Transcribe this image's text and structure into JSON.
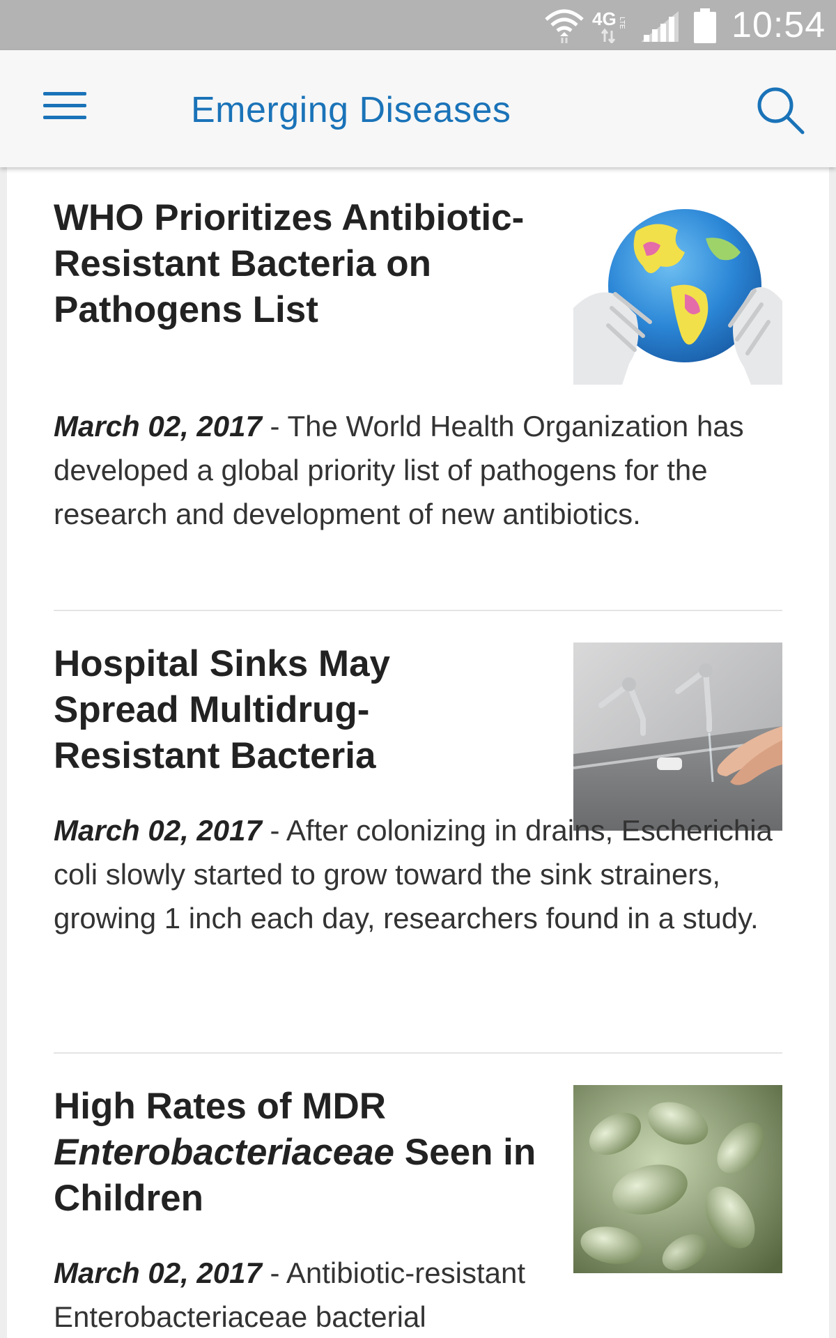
{
  "status_bar": {
    "network": "4G LTE",
    "time": "10:54",
    "icons": [
      "wifi-icon",
      "lte-icon",
      "signal-icon",
      "battery-icon"
    ]
  },
  "app_bar": {
    "title": "Emerging Diseases",
    "menu_icon": "hamburger-menu-icon",
    "search_icon": "search-icon",
    "accent_color": "#1a73b8"
  },
  "articles": [
    {
      "headline": "WHO Prioritizes Antibiotic-Resistant Bacteria on Pathogens List",
      "date": "March 02, 2017",
      "summary": " - The World Health Organization has developed a global priority list of pathogens for the research and development of new antibiotics.",
      "image": "globe-in-gloved-hands"
    },
    {
      "headline": "Hospital Sinks May Spread Multidrug-Resistant Bacteria",
      "date": "March 02, 2017",
      "summary": " - After colonizing in drains, Escherichia coli slowly started to grow toward the sink strainers, growing 1 inch each day, researchers found in a study.",
      "image": "hospital-sink-handwashing"
    },
    {
      "headline_part1": "High Rates of MDR ",
      "headline_italic": "Enterobacteriaceae",
      "headline_part2": " Seen in Children",
      "date": "March 02, 2017",
      "summary": " - Antibiotic-resistant Enterobacteriaceae bacterial",
      "image": "green-bacteria-microscopy"
    }
  ]
}
